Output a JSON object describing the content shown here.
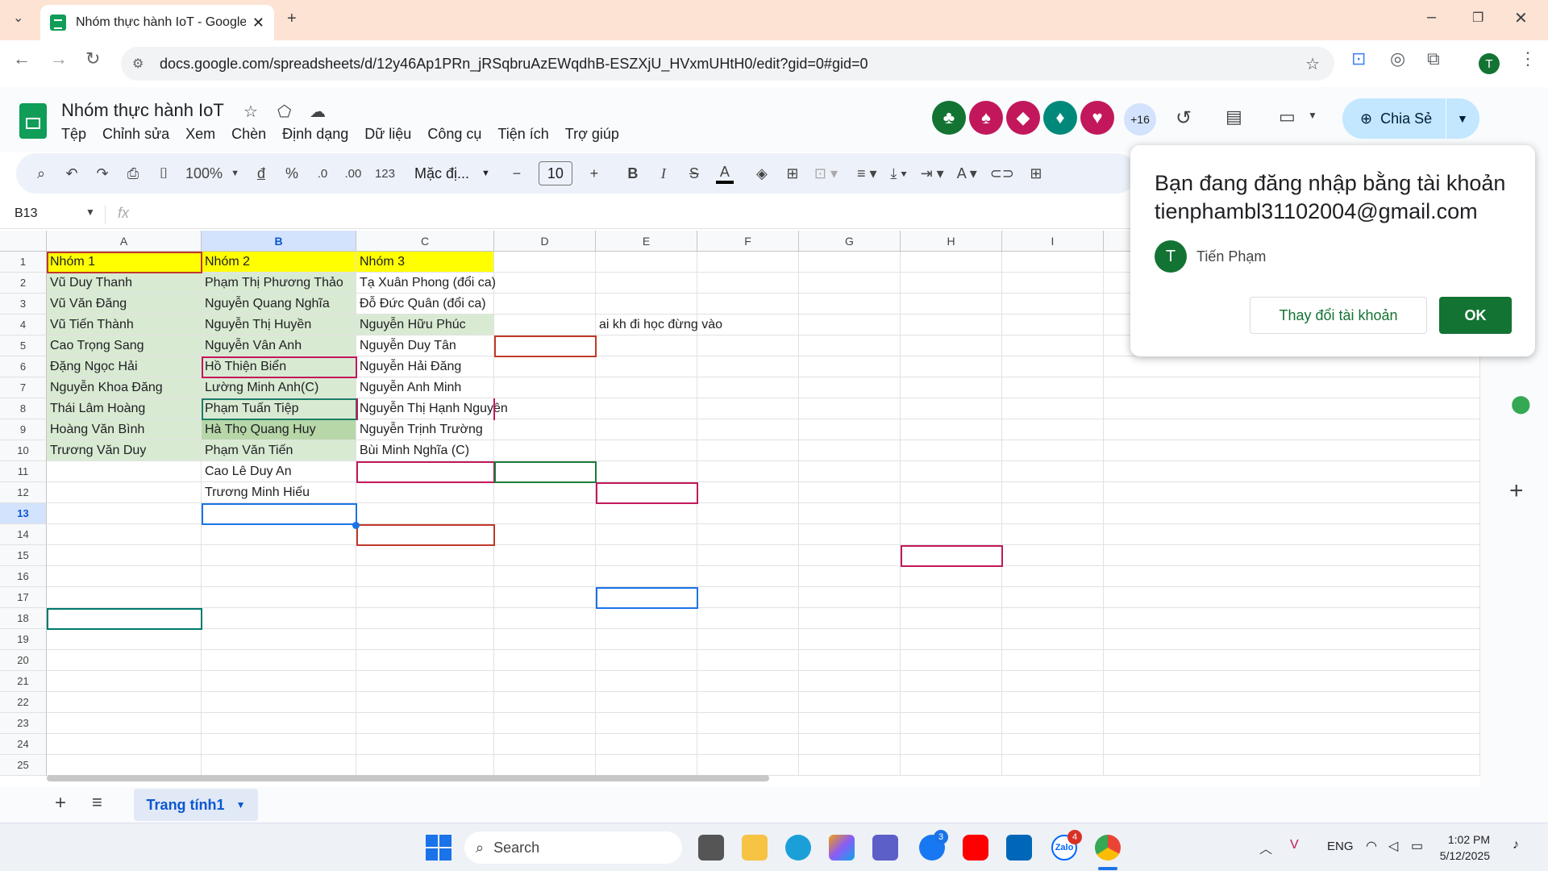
{
  "browser": {
    "tab_title": "Nhóm thực hành IoT - Google T",
    "url": "docs.google.com/spreadsheets/d/12y46Ap1PRn_jRSqbruAzEWqdhB-ESZXjU_HVxmUHtH0/edit?gid=0#gid=0",
    "profile_initial": "T"
  },
  "sheets": {
    "doc_title": "Nhóm thực hành IoT",
    "menu": [
      "Tệp",
      "Chỉnh sửa",
      "Xem",
      "Chèn",
      "Định dạng",
      "Dữ liệu",
      "Công cụ",
      "Tiện ích",
      "Trợ giúp"
    ],
    "collaborators_more": "+16",
    "share_label": "Chia Sẻ",
    "user_initial": "T"
  },
  "toolbar": {
    "zoom": "100%",
    "currency": "đ",
    "percent": "%",
    "dec_decrease": ".0",
    "dec_increase": ".00",
    "number_format": "123",
    "font": "Mặc đị...",
    "font_size": "10"
  },
  "formula_bar": {
    "name_box": "B13",
    "fx": "fx"
  },
  "grid": {
    "columns": [
      "A",
      "B",
      "C",
      "D",
      "E",
      "F",
      "G",
      "H",
      "I"
    ],
    "rows": [
      "1",
      "2",
      "3",
      "4",
      "5",
      "6",
      "7",
      "8",
      "9",
      "10",
      "11",
      "12",
      "13",
      "14",
      "15",
      "16",
      "17",
      "18",
      "19",
      "20",
      "21",
      "22",
      "23",
      "24",
      "25"
    ],
    "colA": [
      "Nhóm 1",
      "Vũ Duy Thanh",
      "Vũ Văn Đăng",
      "Vũ Tiến Thành",
      "Cao Trọng Sang",
      "Đặng Ngọc Hải",
      "Nguyễn Khoa Đăng",
      "Thái Lâm Hoàng",
      "Hoàng Văn Bình",
      "Trương Văn Duy"
    ],
    "colB": [
      "Nhóm 2",
      "Phạm Thị Phương Thảo",
      "Nguyễn Quang Nghĩa",
      "Nguyễn Thị Huyền",
      "Nguyễn Vân Anh",
      "Hồ Thiện Biển",
      "Lường Minh Anh(C)",
      "Phạm Tuấn Tiệp",
      "Hà Thọ Quang Huy",
      "Phạm Văn Tiến",
      "Cao Lê Duy An",
      "Trương Minh Hiếu"
    ],
    "colC": [
      "Nhóm 3",
      "Tạ Xuân Phong (đổi ca)",
      "Đỗ Đức Quân (đổi ca)",
      "Nguyễn Hữu Phúc",
      "Nguyễn Duy Tân",
      "Nguyễn Hải Đăng",
      "Nguyễn Anh Minh",
      "Nguyễn Thị Hạnh Nguyên",
      "Nguyễn Trịnh Trường",
      "Bùi Minh Nghĩa (C)"
    ],
    "e4": "ai kh đi học đừng vào"
  },
  "popup": {
    "title": "Bạn đang đăng nhập bằng tài khoản tienphambl31102004@gmail.com",
    "avatar_initial": "T",
    "name": "Tiến Phạm",
    "change_label": "Thay đổi tài khoản",
    "ok_label": "OK"
  },
  "sheet_tabs": {
    "active": "Trang tính1"
  },
  "taskbar": {
    "search": "Search",
    "teams_badge": "3",
    "zalo_badge": "4",
    "zalo_label": "Zalo",
    "lang": "ENG",
    "time": "1:02 PM",
    "date": "5/12/2025"
  },
  "colors": {
    "sheets_green": "#137333",
    "share_bg": "#c2e7ff",
    "yellow": "#ffff00",
    "light_green": "#d9ead3"
  }
}
